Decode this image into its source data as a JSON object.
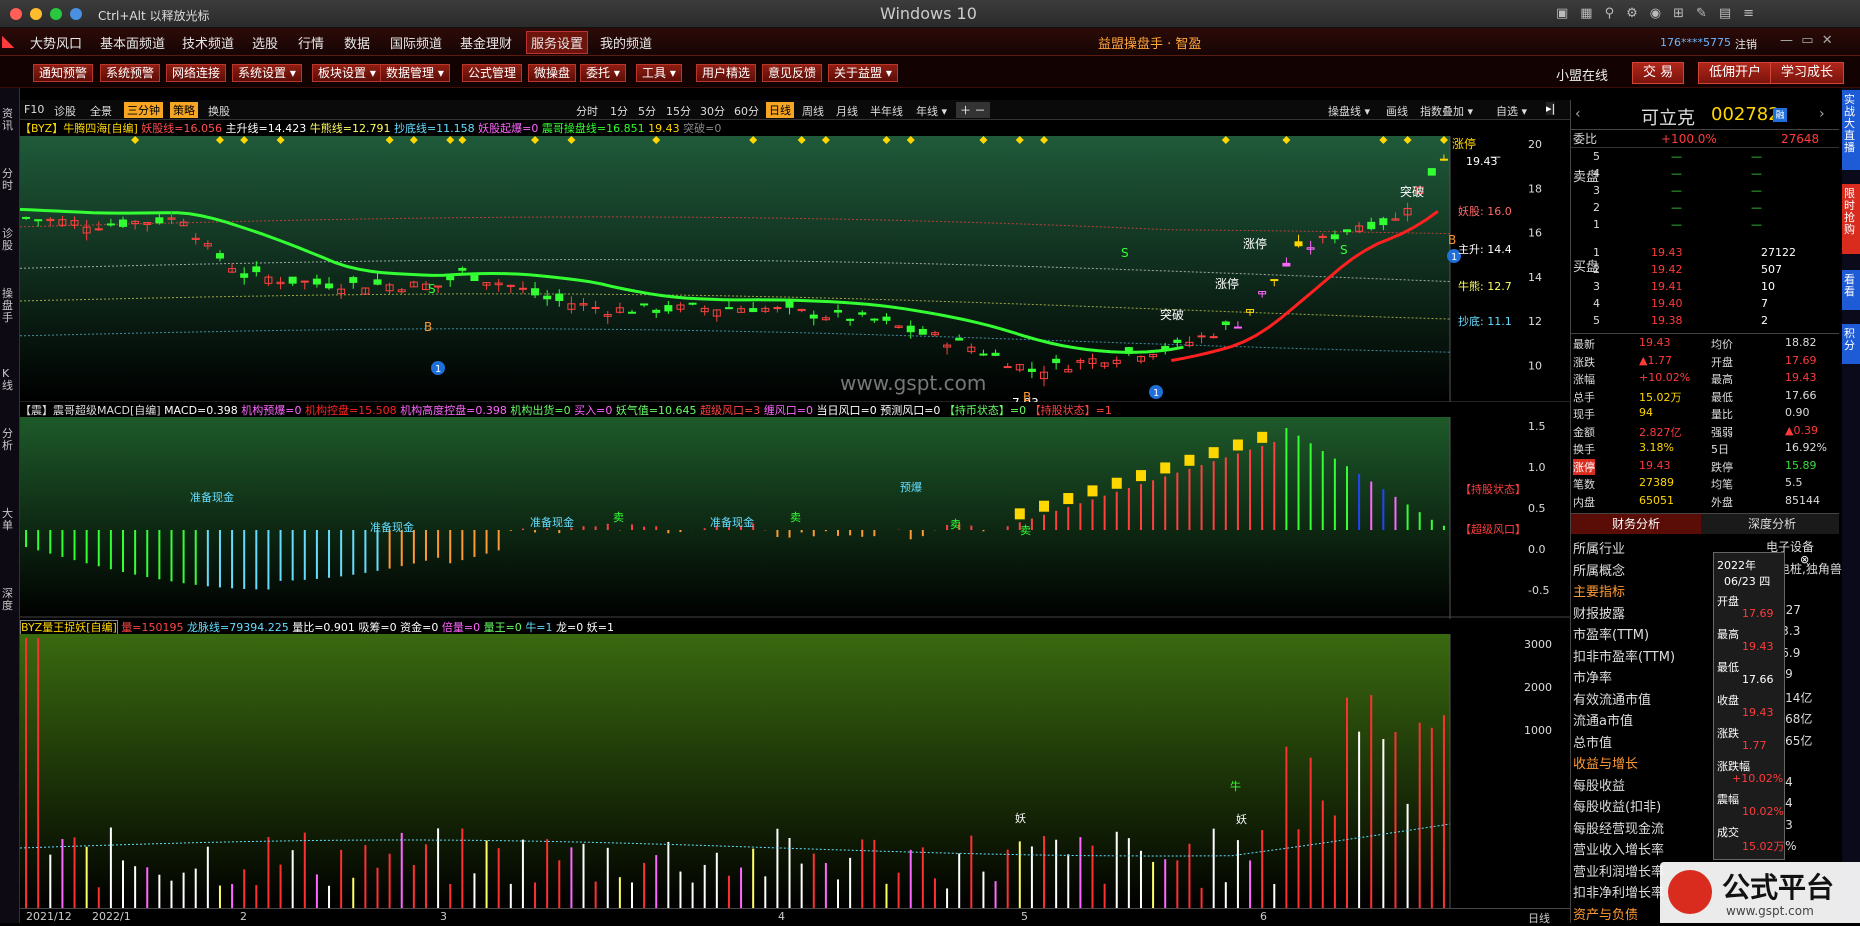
{
  "window": {
    "title": "Windows 10",
    "hint": "Ctrl+Alt 以释放光标"
  },
  "colors": {
    "up": "#ff3b3b",
    "down": "#3bdc3b",
    "accent": "#d92c1f",
    "yellow": "#ffd700"
  },
  "menu": [
    "大势风口",
    "基本面频道",
    "技术频道",
    "选股",
    "行情",
    "数据",
    "国际频道",
    "基金理财",
    "服务设置",
    "我的频道"
  ],
  "app_title": "益盟操盘手 · 智盈",
  "account": "176****5775",
  "logout": "注销",
  "toolbar": [
    "通知预警",
    "系统预警",
    "网络连接",
    "系统设置 ▾",
    "板块设置 ▾",
    "数据管理 ▾",
    "公式管理",
    "微操盘",
    "委托 ▾",
    "工具 ▾",
    "用户精选",
    "意见反馈",
    "关于益盟 ▾"
  ],
  "toolbar_right": {
    "status": "小盟在线",
    "trade": "交 易",
    "open": "低佣开户",
    "learn": "学习成长"
  },
  "left_tabs": [
    "资讯",
    "分时",
    "诊股",
    "操盘手",
    "K线",
    "分析",
    "大单",
    "深度"
  ],
  "right_tabs": [
    "实战大直播",
    "限时抢购",
    "看看",
    "积分"
  ],
  "chart_toolbar": {
    "items": [
      "F10",
      "诊股",
      "全景",
      "三分钟",
      "策略",
      "换股"
    ],
    "periods": [
      "分时",
      "1分",
      "5分",
      "15分",
      "30分",
      "60分",
      "日线",
      "周线",
      "月线",
      "半年线",
      "年线 ▾"
    ],
    "right": [
      "操盘线 ▾",
      "画线",
      "指数叠加 ▾",
      "自选 ▾"
    ]
  },
  "main_indicator": {
    "name": "【BYZ】牛腾四海[自编]",
    "items": [
      "妖股线=16.056",
      "主升线=14.423",
      "牛熊线=12.791",
      "抄底线=11.158",
      "妖股起爆=0",
      "震哥操盘线=16.851",
      "19.43",
      "突破=0"
    ]
  },
  "main_axis": [
    "20",
    "18",
    "16",
    "14",
    "12",
    "10",
    "8"
  ],
  "main_right_labels": [
    {
      "t": "19.43"
    },
    {
      "t": "妖股: 16.0"
    },
    {
      "t": "主升: 14.4"
    },
    {
      "t": "牛熊: 12.7"
    },
    {
      "t": "抄底: 11.1"
    }
  ],
  "main_annotations": [
    "突破",
    "涨停",
    "涨停",
    "涨停",
    "突破",
    "突破",
    "涨停",
    "7.93",
    "S",
    "S",
    "S",
    "B",
    "B",
    "B",
    "1",
    "1",
    "1"
  ],
  "watermark": "www.gspt.com",
  "macd_indicator": {
    "name": "【震】震哥超级MACD[自编]",
    "items": [
      "MACD=0.398",
      "机构预爆=0",
      "机构控盘=15.508",
      "机构高度控盘=0.398",
      "机构出货=0",
      "买入=0",
      "妖气值=10.645",
      "超级风口=3",
      "缠风口=0",
      "当日风口=0",
      "预测风口=0",
      "【持币状态】=0",
      "【持股状态】=1"
    ]
  },
  "macd_axis": [
    "1.5",
    "1.0",
    "0.5",
    "0.0",
    "-0.5"
  ],
  "macd_labels": [
    "准备现金",
    "准备现金",
    "准备现金",
    "准备现金",
    "预爆",
    "卖",
    "卖",
    "卖",
    "卖",
    "卖",
    "【持股状态】",
    "【超级风口】"
  ],
  "vol_indicator": {
    "name": "BYZ量王捉妖[自编]",
    "items": [
      "量=150195",
      "龙脉线=79394.225",
      "量比=0.901",
      "吸筹=0",
      "资金=0",
      "倍量=0",
      "量王=0",
      "牛=1",
      "龙=0",
      "妖=1"
    ]
  },
  "vol_axis": [
    "3000",
    "2000",
    "1000"
  ],
  "vol_labels": [
    "妖",
    "妖",
    "牛"
  ],
  "xaxis": [
    "2021/12",
    "2022/1",
    "2",
    "3",
    "4",
    "5",
    "6"
  ],
  "xaxis_right": "日线",
  "quote": {
    "name": "可立克",
    "code": "002782",
    "webi": "委比",
    "webi_val": "+100.0%",
    "webi_num": "27648",
    "sell": [
      {
        "n": "5",
        "p": "—",
        "v": "—"
      },
      {
        "n": "4",
        "p": "—",
        "v": "—"
      },
      {
        "n": "3",
        "p": "—",
        "v": "—"
      },
      {
        "n": "2",
        "p": "—",
        "v": "—"
      },
      {
        "n": "1",
        "p": "—",
        "v": "—"
      }
    ],
    "buy": [
      {
        "n": "1",
        "p": "19.43",
        "v": "27122"
      },
      {
        "n": "2",
        "p": "19.42",
        "v": "507"
      },
      {
        "n": "3",
        "p": "19.41",
        "v": "10"
      },
      {
        "n": "4",
        "p": "19.40",
        "v": "7"
      },
      {
        "n": "5",
        "p": "19.38",
        "v": "2"
      }
    ],
    "sell_label": "卖盘",
    "buy_label": "买盘",
    "stats": [
      [
        "最新",
        "19.43",
        "均价",
        "18.82"
      ],
      [
        "涨跌",
        "▲1.77",
        "开盘",
        "17.69"
      ],
      [
        "涨幅",
        "+10.02%",
        "最高",
        "19.43"
      ],
      [
        "总手",
        "15.02万",
        "最低",
        "17.66"
      ],
      [
        "现手",
        "94",
        "量比",
        "0.90"
      ],
      [
        "金额",
        "2.827亿",
        "强弱",
        "▲0.39"
      ],
      [
        "换手",
        "3.18%",
        "5日",
        "16.92%"
      ],
      [
        "涨停",
        "19.43",
        "跌停",
        "15.89"
      ],
      [
        "笔数",
        "27389",
        "均笔",
        "5.5"
      ],
      [
        "内盘",
        "65051",
        "外盘",
        "85144"
      ]
    ],
    "tabs": [
      "财务分析",
      "深度分析"
    ],
    "fin": [
      [
        "所属行业",
        "电子设备"
      ],
      [
        "所属概念",
        "充电桩,独角兽,光伏..."
      ],
      [
        "主要指标",
        ""
      ],
      [
        "财报披露",
        "04-27"
      ],
      [
        "市盈率(TTM)",
        "333.3"
      ],
      [
        "扣非市盈率(TTM)",
        "146.9"
      ],
      [
        "市净率",
        "6.19"
      ],
      [
        "有效流通市值",
        "84.14亿"
      ],
      [
        "流通a市值",
        "91.68亿"
      ],
      [
        "总市值",
        "92.65亿"
      ],
      [
        "收益与增长",
        ""
      ],
      [
        "每股收益",
        "0.04"
      ],
      [
        "每股收益(扣非)",
        "0.04"
      ],
      [
        "每股经营现金流",
        "0.03"
      ],
      [
        "营业收入增长率",
        "9.1%"
      ],
      [
        "营业利润增长率",
        ""
      ],
      [
        "扣非净利增长率",
        ""
      ],
      [
        "资产与负债",
        ""
      ]
    ],
    "tooltip": {
      "year": "2022年",
      "date": "06/23 四",
      "items": [
        [
          "开盘",
          "17.69"
        ],
        [
          "最高",
          "19.43"
        ],
        [
          "最低",
          "17.66"
        ],
        [
          "收盘",
          "19.43"
        ],
        [
          "涨跌",
          "1.77"
        ],
        [
          "涨跌幅",
          "+10.02%"
        ],
        [
          "震幅",
          "10.02%"
        ],
        [
          "成交",
          "15.02万"
        ]
      ]
    }
  },
  "brand": {
    "name": "公式平台",
    "url": "www.gspt.com"
  }
}
